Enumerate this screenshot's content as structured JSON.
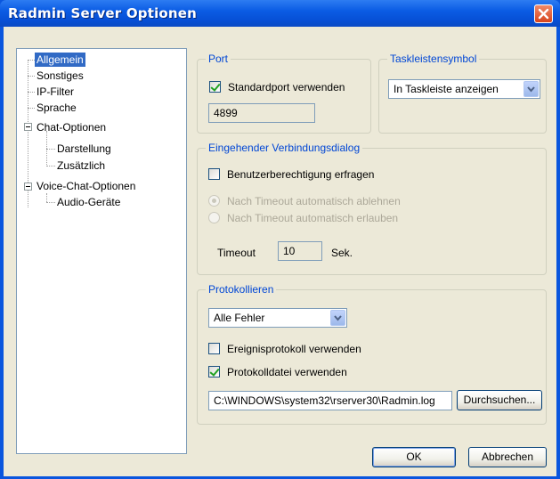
{
  "window": {
    "title": "Radmin Server Optionen"
  },
  "tree": {
    "items": [
      {
        "label": "Allgemein",
        "selected": true
      },
      {
        "label": "Sonstiges"
      },
      {
        "label": "IP-Filter"
      },
      {
        "label": "Sprache"
      },
      {
        "label": "Chat-Optionen",
        "expanded": true
      },
      {
        "label": "Darstellung"
      },
      {
        "label": "Zusätzlich"
      },
      {
        "label": "Voice-Chat-Optionen",
        "expanded": true
      },
      {
        "label": "Audio-Geräte"
      }
    ]
  },
  "port": {
    "legend": "Port",
    "use_default_label": "Standardport verwenden",
    "use_default_checked": true,
    "value": "4899"
  },
  "tray": {
    "legend": "Taskleistensymbol",
    "selected": "In Taskleiste anzeigen"
  },
  "incoming": {
    "legend": "Eingehender Verbindungsdialog",
    "ask_permission_label": "Benutzerberechtigung erfragen",
    "ask_permission_checked": false,
    "radio_reject_label": "Nach Timeout automatisch ablehnen",
    "radio_allow_label": "Nach Timeout automatisch erlauben",
    "timeout_label": "Timeout",
    "timeout_value": "10",
    "timeout_unit": "Sek."
  },
  "logging": {
    "legend": "Protokollieren",
    "level_selected": "Alle Fehler",
    "event_log_label": "Ereignisprotokoll verwenden",
    "event_log_checked": false,
    "logfile_label": "Protokolldatei verwenden",
    "logfile_checked": true,
    "logfile_path": "C:\\WINDOWS\\system32\\rserver30\\Radmin.log",
    "browse_label": "Durchsuchen..."
  },
  "buttons": {
    "ok": "OK",
    "cancel": "Abbrechen"
  }
}
